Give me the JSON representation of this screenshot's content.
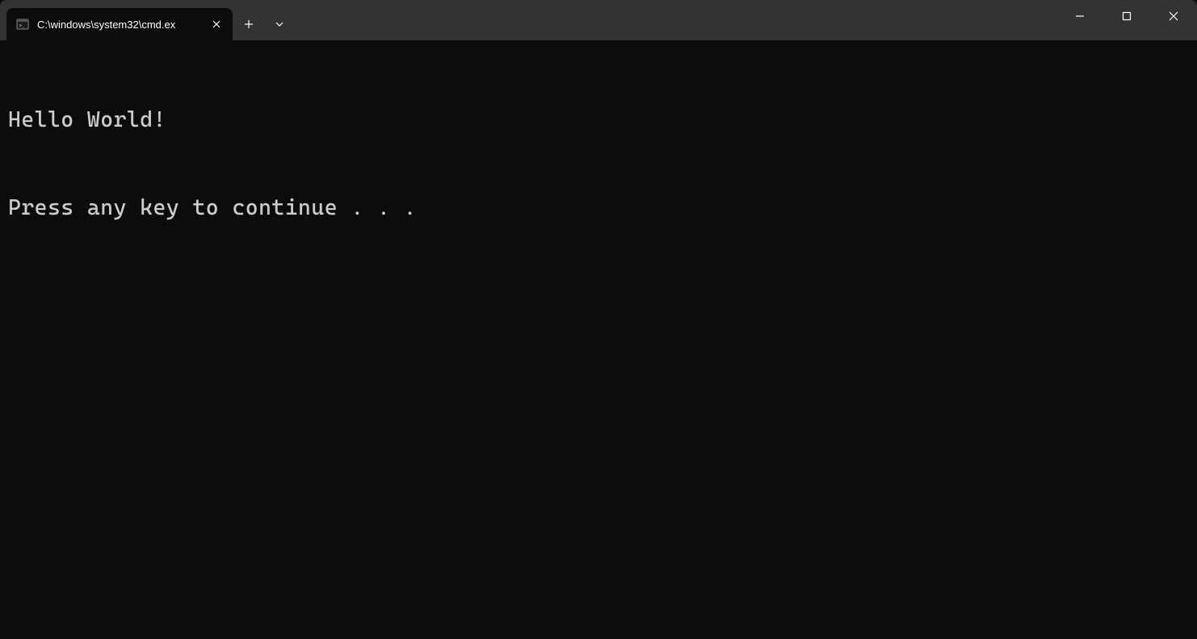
{
  "titlebar": {
    "tab": {
      "title": "C:\\windows\\system32\\cmd.ex",
      "icon": "terminal-icon"
    }
  },
  "terminal": {
    "lines": [
      "Hello World!",
      "Press any key to continue . . ."
    ]
  }
}
